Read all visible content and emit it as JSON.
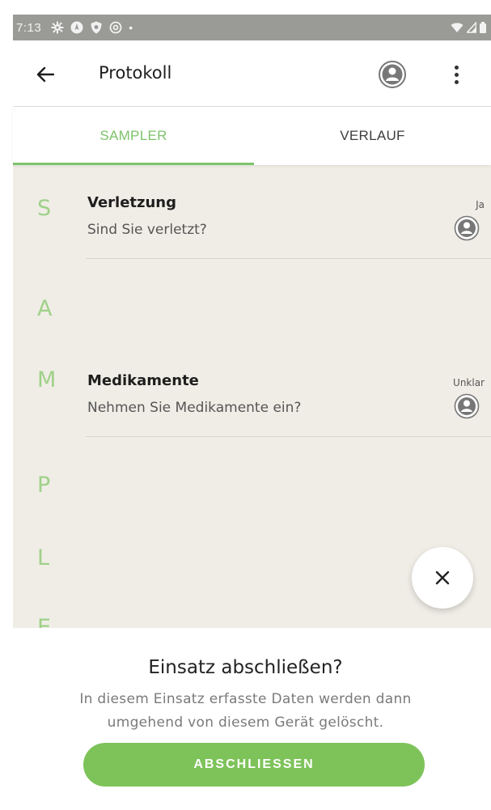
{
  "status_bar": {
    "time": "7:13",
    "notification_icons": [
      "gear-icon",
      "compass-icon",
      "shield-icon",
      "at-icon"
    ],
    "dot": "•"
  },
  "app_bar": {
    "title": "Protokoll"
  },
  "tabs": [
    {
      "label": "SAMPLER",
      "active": true
    },
    {
      "label": "VERLAUF",
      "active": false
    }
  ],
  "sampler": {
    "letters": [
      "S",
      "A",
      "M",
      "P",
      "L",
      "E"
    ],
    "entries": [
      {
        "title": "Verletzung",
        "question": "Sind Sie verletzt?",
        "answer": "Ja"
      },
      {
        "title": "Medikamente",
        "question": "Nehmen Sie Medikamente ein?",
        "answer": "Unklar"
      }
    ]
  },
  "sheet": {
    "title": "Einsatz abschließen?",
    "message": "In diesem Einsatz erfasste Daten werden dann umgehend von diesem Gerät gelöscht.",
    "confirm_label": "ABSCHLIESSEN"
  },
  "colors": {
    "accent": "#7ec36b",
    "button": "#7ec35a",
    "content_bg": "#f0ede6",
    "status_bar_bg": "#9a9a96"
  }
}
